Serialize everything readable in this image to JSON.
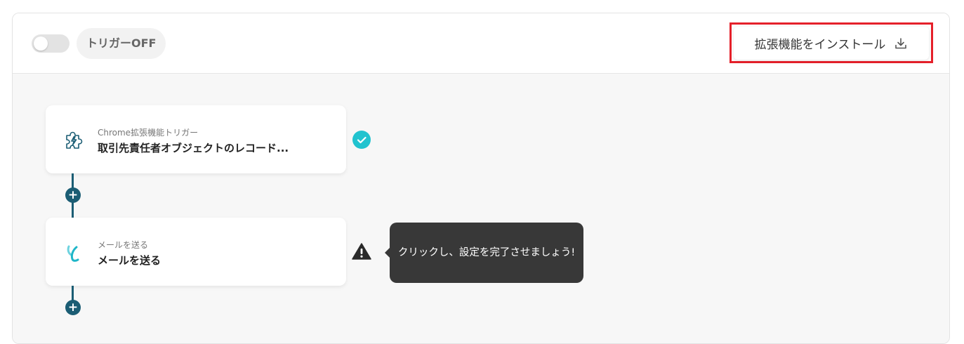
{
  "trigger": {
    "toggle_state": "off",
    "status_label": "トリガーOFF"
  },
  "install_button": {
    "label": "拡張機能をインストール",
    "icon": "download-icon",
    "highlight_color": "#e5202a"
  },
  "steps": [
    {
      "icon": "puzzle-lightning-icon",
      "subtitle": "Chrome拡張機能トリガー",
      "title": "取引先責任者オブジェクトのレコード...",
      "status": "complete",
      "status_icon": "check-circle-icon"
    },
    {
      "icon": "mail-brand-icon",
      "subtitle": "メールを送る",
      "title": "メールを送る",
      "status": "incomplete",
      "status_icon": "warning-icon"
    }
  ],
  "tooltip": {
    "text": "クリックし、設定を完了させましょう!"
  },
  "colors": {
    "accent_dark": "#1b5d74",
    "success": "#21c3cf",
    "tooltip_bg": "#383838"
  }
}
